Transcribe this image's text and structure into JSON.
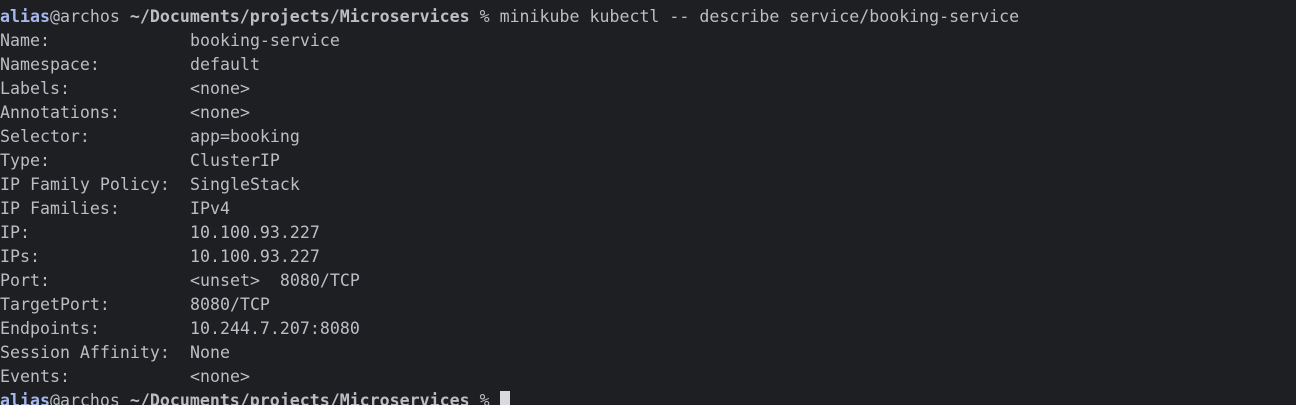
{
  "prompt": {
    "user": "alias",
    "at": "@",
    "host": "archos",
    "path": "~/Documents/projects/Microservices",
    "symbol": "%"
  },
  "command": "minikube kubectl -- describe service/booking-service",
  "output": [
    {
      "key": "Name:",
      "value": "booking-service"
    },
    {
      "key": "Namespace:",
      "value": "default"
    },
    {
      "key": "Labels:",
      "value": "<none>"
    },
    {
      "key": "Annotations:",
      "value": "<none>"
    },
    {
      "key": "Selector:",
      "value": "app=booking"
    },
    {
      "key": "Type:",
      "value": "ClusterIP"
    },
    {
      "key": "IP Family Policy:",
      "value": "SingleStack"
    },
    {
      "key": "IP Families:",
      "value": "IPv4"
    },
    {
      "key": "IP:",
      "value": "10.100.93.227"
    },
    {
      "key": "IPs:",
      "value": "10.100.93.227"
    },
    {
      "key": "Port:",
      "value": "<unset>  8080/TCP"
    },
    {
      "key": "TargetPort:",
      "value": "8080/TCP"
    },
    {
      "key": "Endpoints:",
      "value": "10.244.7.207:8080"
    },
    {
      "key": "Session Affinity:",
      "value": "None"
    },
    {
      "key": "Events:",
      "value": "<none>"
    }
  ],
  "colors": {
    "background": "#1e1f22",
    "text": "#bcbec4",
    "user": "#a7b8ec",
    "cursor": "#d9dadd"
  }
}
